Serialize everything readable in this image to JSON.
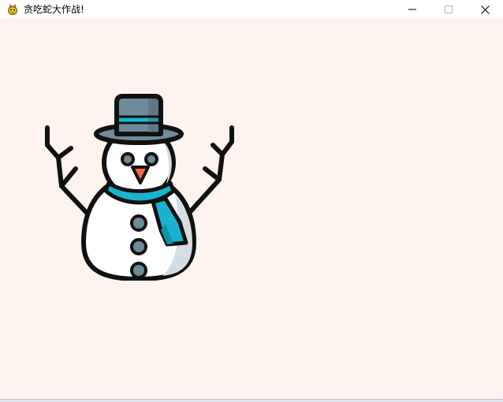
{
  "window": {
    "title": "贪吃蛇大作战!",
    "app_icon": "pygame-snake-icon",
    "controls": {
      "minimize_icon": "minimize-icon",
      "maximize_icon": "maximize-icon",
      "close_icon": "close-icon"
    }
  },
  "canvas": {
    "background_color": "#fef4ef",
    "sprite": "snowman-icon",
    "colors": {
      "outline": "#111111",
      "hat": "#6f8a9a",
      "hat_band": "#19b7cc",
      "scarf": "#18b4cf",
      "scarf_dark": "#0e93a8",
      "nose": "#f26b3a",
      "snow": "#ffffff",
      "snow_shade": "#d5dde3",
      "buttons": "#6f8a9a"
    }
  }
}
